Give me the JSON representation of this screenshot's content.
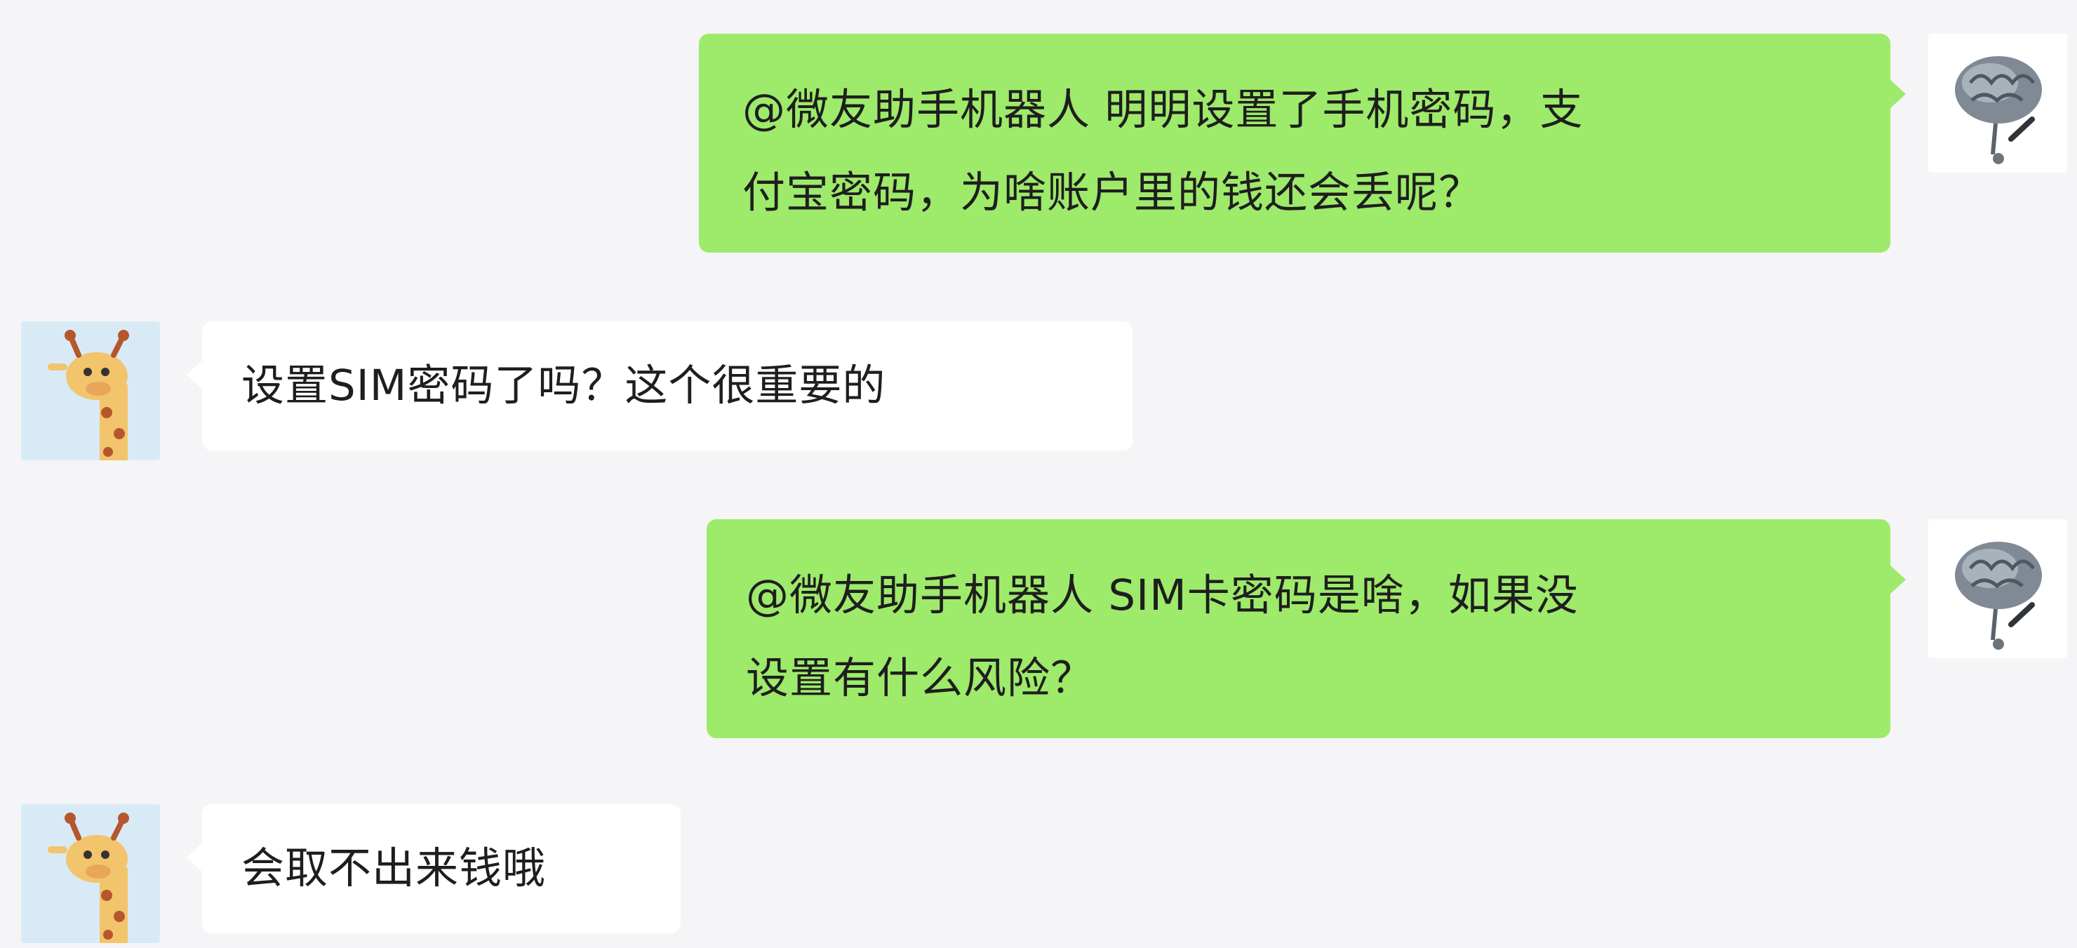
{
  "chat": {
    "messages": [
      {
        "direction": "outgoing",
        "sender_avatar": "brain-sketch-avatar",
        "line1": "@微友助手机器人 明明设置了手机密码，支",
        "line2": "付宝密码，为啥账户里的钱还会丢呢？"
      },
      {
        "direction": "incoming",
        "sender_avatar": "giraffe-avatar",
        "line1": "设置SIM密码了吗？这个很重要的"
      },
      {
        "direction": "outgoing",
        "sender_avatar": "brain-sketch-avatar",
        "line1": "@微友助手机器人 SIM卡密码是啥，如果没",
        "line2": "设置有什么风险？"
      },
      {
        "direction": "incoming",
        "sender_avatar": "giraffe-avatar",
        "line1": "会取不出来钱哦"
      }
    ]
  },
  "colors": {
    "background": "#f5f5f7",
    "outgoing_bubble": "#9eea6a",
    "incoming_bubble": "#ffffff",
    "text": "#1e1e1e"
  }
}
